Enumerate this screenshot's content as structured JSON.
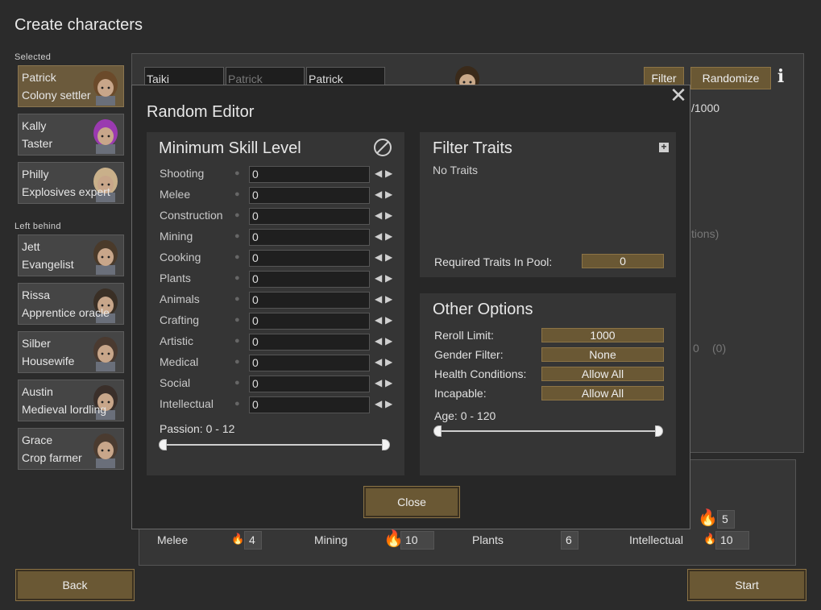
{
  "page": {
    "title": "Create characters"
  },
  "sections": {
    "selected_label": "Selected",
    "left_behind_label": "Left behind"
  },
  "selected_pawns": [
    {
      "name": "Patrick",
      "role": "Colony settler"
    },
    {
      "name": "Kally",
      "role": "Taster"
    },
    {
      "name": "Philly",
      "role": "Explosives expert"
    }
  ],
  "left_behind_pawns": [
    {
      "name": "Jett",
      "role": "Evangelist"
    },
    {
      "name": "Rissa",
      "role": "Apprentice oracle"
    },
    {
      "name": "Silber",
      "role": "Housewife"
    },
    {
      "name": "Austin",
      "role": "Medieval lordling"
    },
    {
      "name": "Grace",
      "role": "Crop farmer"
    }
  ],
  "editor_bg": {
    "name_first": "Taiki",
    "name_nick": "Patrick",
    "name_last": "Patrick",
    "filter_label": "Filter",
    "randomize_label": "Randomize",
    "info_icon": "i",
    "counter_text": "/1000",
    "partial_text_1": "tions)",
    "partial_text_2": "0",
    "partial_text_3": "(0)"
  },
  "bg_skills": {
    "melee": {
      "label": "Melee",
      "value": "4"
    },
    "mining": {
      "label": "Mining",
      "value": "10"
    },
    "plants": {
      "label": "Plants",
      "value": "6"
    },
    "intellectual": {
      "label": "Intellectual",
      "value": "10"
    },
    "partial_value": "5"
  },
  "buttons": {
    "back": "Back",
    "start": "Start"
  },
  "modal": {
    "title": "Random Editor",
    "close_icon": "✕",
    "close_label": "Close",
    "min_skill": {
      "title": "Minimum Skill Level",
      "skills": [
        {
          "label": "Shooting",
          "value": "0"
        },
        {
          "label": "Melee",
          "value": "0"
        },
        {
          "label": "Construction",
          "value": "0"
        },
        {
          "label": "Mining",
          "value": "0"
        },
        {
          "label": "Cooking",
          "value": "0"
        },
        {
          "label": "Plants",
          "value": "0"
        },
        {
          "label": "Animals",
          "value": "0"
        },
        {
          "label": "Crafting",
          "value": "0"
        },
        {
          "label": "Artistic",
          "value": "0"
        },
        {
          "label": "Medical",
          "value": "0"
        },
        {
          "label": "Social",
          "value": "0"
        },
        {
          "label": "Intellectual",
          "value": "0"
        }
      ],
      "passion_label": "Passion: 0 - 12"
    },
    "filter_traits": {
      "title": "Filter Traits",
      "empty_text": "No Traits",
      "required_label": "Required Traits In Pool:",
      "required_value": "0"
    },
    "other_options": {
      "title": "Other Options",
      "reroll_label": "Reroll Limit:",
      "reroll_value": "1000",
      "gender_label": "Gender Filter:",
      "gender_value": "None",
      "health_label": "Health Conditions:",
      "health_value": "Allow All",
      "incapable_label": "Incapable:",
      "incapable_value": "Allow All",
      "age_label": "Age: 0 - 120"
    }
  }
}
